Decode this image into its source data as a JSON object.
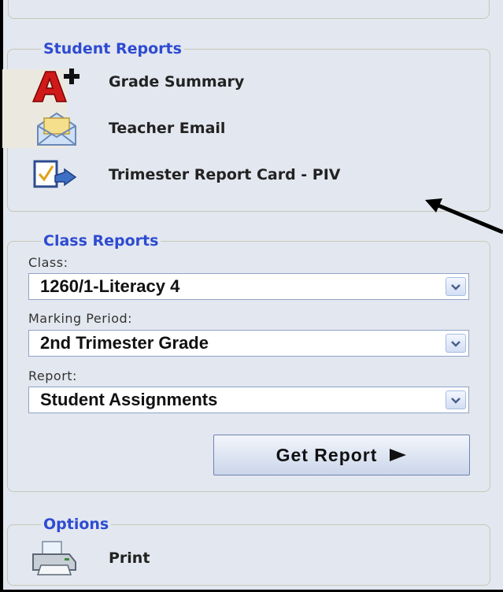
{
  "student_reports": {
    "legend": "Student Reports",
    "items": [
      {
        "label": "Grade Summary",
        "icon": "grade-a-plus-icon"
      },
      {
        "label": "Teacher Email",
        "icon": "email-envelope-icon"
      },
      {
        "label": "Trimester Report Card - PIV",
        "icon": "report-card-icon"
      }
    ]
  },
  "class_reports": {
    "legend": "Class Reports",
    "class_label": "Class:",
    "class_value": "1260/1-Literacy 4",
    "marking_period_label": "Marking Period:",
    "marking_period_value": "2nd Trimester Grade",
    "report_label": "Report:",
    "report_value": "Student Assignments",
    "get_report_label": "Get Report"
  },
  "options": {
    "legend": "Options",
    "print_label": "Print",
    "print_icon": "printer-icon"
  },
  "annotation": {
    "arrow_icon": "pointer-arrow-icon"
  },
  "colors": {
    "legend": "#2e4bd1",
    "panel_bg": "#e3e7ef",
    "panel_border": "#c5c9b8",
    "select_border": "#8fa3c9"
  }
}
